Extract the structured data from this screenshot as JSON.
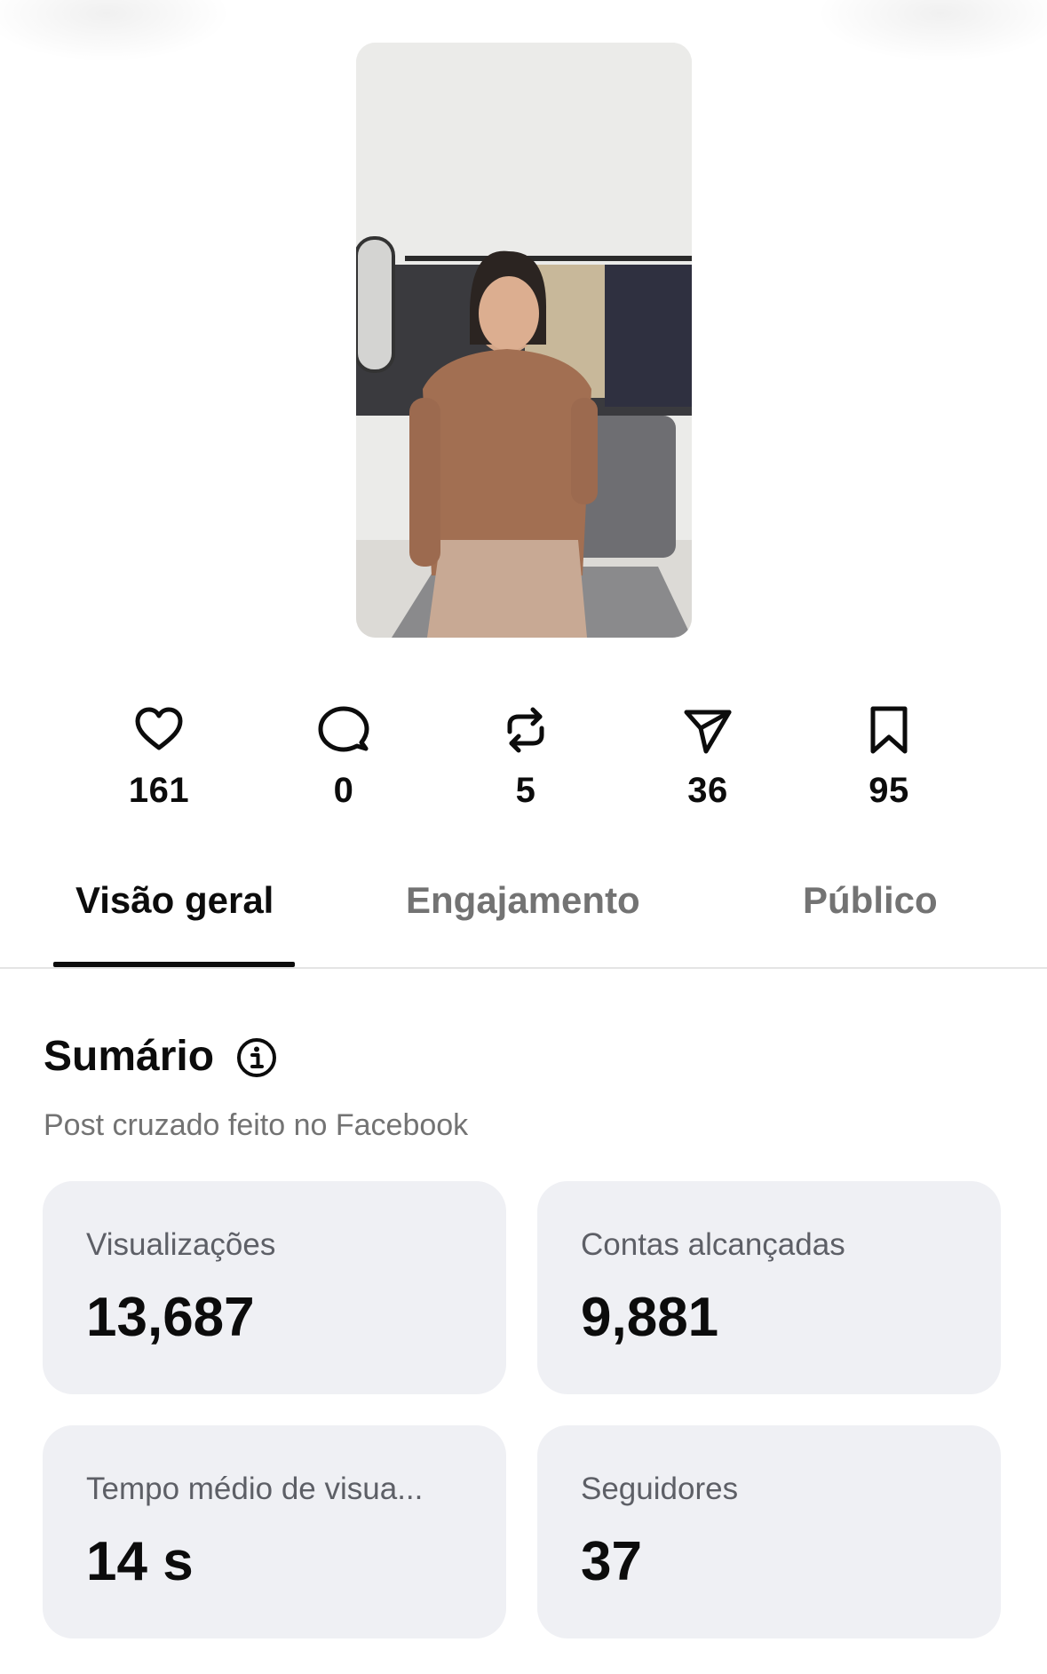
{
  "stats": [
    {
      "icon": "heart-icon",
      "value": "161"
    },
    {
      "icon": "comment-icon",
      "value": "0"
    },
    {
      "icon": "repost-icon",
      "value": "5"
    },
    {
      "icon": "share-icon",
      "value": "36"
    },
    {
      "icon": "bookmark-icon",
      "value": "95"
    }
  ],
  "tabs": [
    {
      "label": "Visão geral",
      "active": true
    },
    {
      "label": "Engajamento",
      "active": false
    },
    {
      "label": "Público",
      "active": false
    }
  ],
  "summary": {
    "title": "Sumário",
    "subtitle": "Post cruzado feito no Facebook",
    "cards": [
      {
        "label": "Visualizações",
        "value": "13,687"
      },
      {
        "label": "Contas alcançadas",
        "value": "9,881"
      },
      {
        "label": "Tempo médio de visua...",
        "value": "14 s"
      },
      {
        "label": "Seguidores",
        "value": "37"
      }
    ]
  },
  "colors": {
    "text": "#0c0c0c",
    "muted": "#737373",
    "card_bg": "#eff0f4"
  }
}
